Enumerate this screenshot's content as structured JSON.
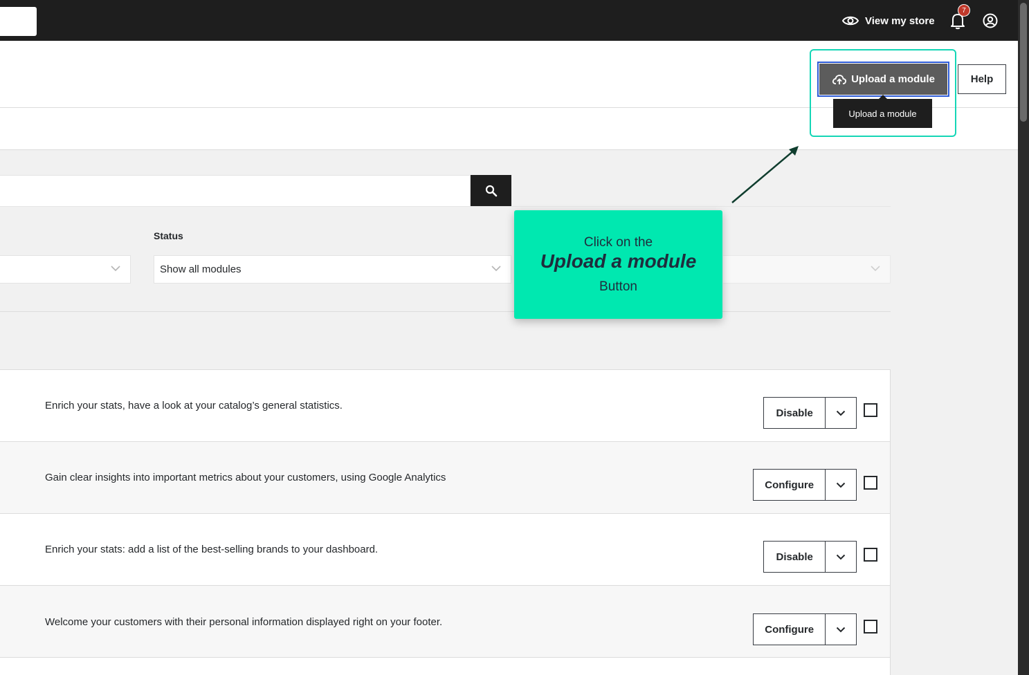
{
  "topbar": {
    "view_store_label": "View my store",
    "notification_count": "7"
  },
  "header": {
    "upload_button_label": "Upload a module",
    "help_button_label": "Help",
    "tooltip_text": "Upload a module"
  },
  "filters": {
    "status_label": "Status",
    "status_value": "Show all modules"
  },
  "modules": [
    {
      "description": "Enrich your stats, have a look at your catalog’s general statistics.",
      "action": "Disable"
    },
    {
      "description": "Gain clear insights into important metrics about your customers, using Google Analytics",
      "action": "Configure"
    },
    {
      "description": "Enrich your stats: add a list of the best-selling brands to your dashboard.",
      "action": "Disable"
    },
    {
      "description": "Welcome your customers with their personal information displayed right on your footer.",
      "action": "Configure"
    }
  ],
  "callout": {
    "line1": "Click on the",
    "line2": "Upload a module",
    "line3": "Button"
  },
  "colors": {
    "callout_bg": "#00e8b0",
    "highlight_border": "#14d6b6",
    "topbar_bg": "#1e1e1e"
  }
}
